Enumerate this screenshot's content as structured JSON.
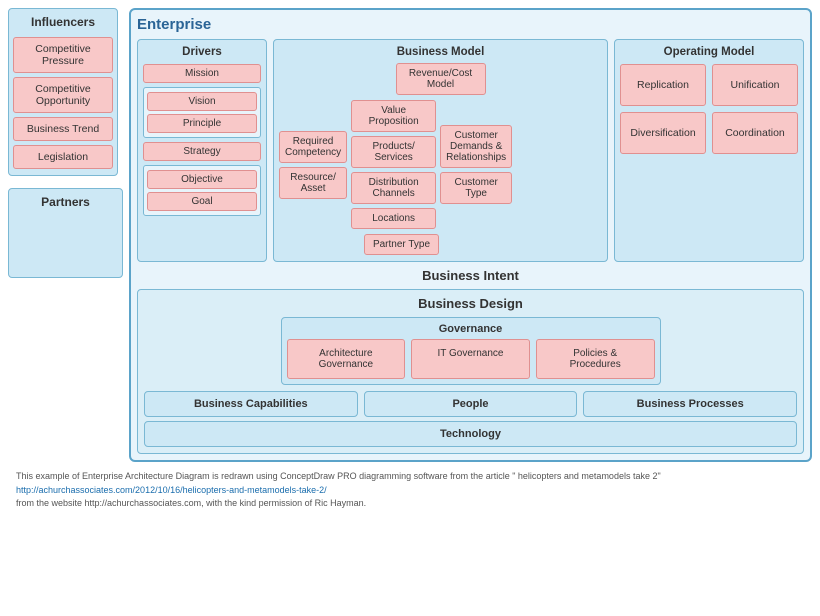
{
  "enterprise": {
    "title": "Enterprise",
    "businessIntentLabel": "Business Intent",
    "businessDesignLabel": "Business Design"
  },
  "influencers": {
    "title": "Influencers",
    "items": [
      {
        "label": "Competitive\nPressure"
      },
      {
        "label": "Competitive\nOpportunity"
      },
      {
        "label": "Business Trend"
      },
      {
        "label": "Legislation"
      }
    ]
  },
  "partners": {
    "title": "Partners"
  },
  "drivers": {
    "title": "Drivers",
    "items": [
      {
        "label": "Mission"
      },
      {
        "label": "Vision"
      },
      {
        "label": "Principle"
      },
      {
        "label": "Strategy"
      },
      {
        "label": "Objective"
      },
      {
        "label": "Goal"
      }
    ]
  },
  "businessModel": {
    "title": "Business Model",
    "items": [
      {
        "label": "Revenue/Cost\nModel"
      },
      {
        "label": "Required\nCompetency"
      },
      {
        "label": "Value\nProposition"
      },
      {
        "label": "Customer\nDemands &\nRelationships"
      },
      {
        "label": "Resource/\nAsset"
      },
      {
        "label": "Products/\nServices"
      },
      {
        "label": "Customer\nType"
      },
      {
        "label": "Partner Type"
      },
      {
        "label": "Distribution\nChannels"
      },
      {
        "label": "Locations"
      }
    ]
  },
  "operatingModel": {
    "title": "Operating Model",
    "items": [
      {
        "label": "Replication"
      },
      {
        "label": "Unification"
      },
      {
        "label": "Diversification"
      },
      {
        "label": "Coordination"
      }
    ]
  },
  "governance": {
    "title": "Governance",
    "items": [
      {
        "label": "Architecture\nGovernance"
      },
      {
        "label": "IT Governance"
      },
      {
        "label": "Policies &\nProcedures"
      }
    ]
  },
  "bottomRow": {
    "capabilities": "Business Capabilities",
    "people": "People",
    "processes": "Business Processes",
    "technology": "Technology"
  },
  "footer": {
    "text1": "This example of Enterprise Architecture Diagram is redrawn using ConceptDraw PRO diagramming software  from the article \" helicopters and metamodels take 2\"",
    "link": "http://achurchassociates.com/2012/10/16/helicopters-and-metamodels-take-2/",
    "text2": "from the website http://achurchassociates.com,  with the kind permission of Ric Hayman."
  }
}
